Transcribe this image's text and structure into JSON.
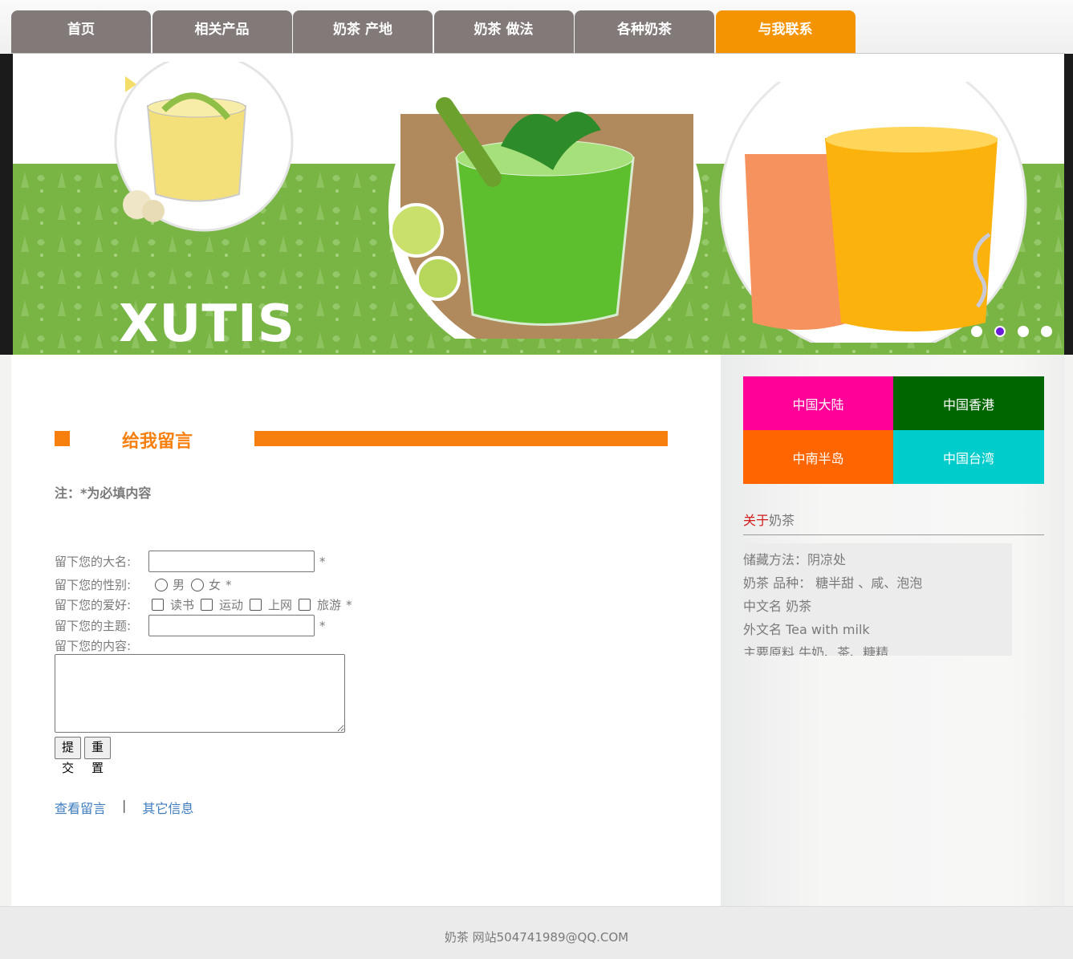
{
  "nav": {
    "tabs": [
      "首页",
      "相关产品",
      "奶茶 产地",
      "奶茶 做法",
      "各种奶茶",
      "与我联系"
    ],
    "active_index": 5,
    "active_color": "#f59403",
    "tab_color": "#827a79"
  },
  "banner": {
    "logo_text": "XUTIS",
    "slide_count": 4,
    "active_slide": 2
  },
  "section": {
    "title": "给我留言",
    "accent_color": "#f77f0e"
  },
  "note": "注：*为必填内容",
  "form": {
    "name_label": "留下您的大名:",
    "gender_label": "留下您的性别:",
    "gender_options": [
      "男",
      "女"
    ],
    "hobby_label": "留下您的爱好:",
    "hobby_options": [
      "读书",
      "运动",
      "上网",
      "旅游"
    ],
    "subject_label": "留下您的主题:",
    "content_label": "留下您的内容:",
    "required_mark": "*",
    "submit_label": "提交",
    "reset_label": "重置"
  },
  "links": {
    "view_messages": "查看留言",
    "separator": "|",
    "other_info": "其它信息"
  },
  "sidebar": {
    "regions": [
      {
        "label": "中国大陆",
        "color": "#ff0099"
      },
      {
        "label": "中国香港",
        "color": "#006600"
      },
      {
        "label": "中南半岛",
        "color": "#ff6600"
      },
      {
        "label": "中国台湾",
        "color": "#00cccc"
      }
    ],
    "about_prefix": "关于",
    "about_suffix": "奶茶",
    "info_lines": [
      "储藏方法：阴凉处",
      "奶茶 品种：  糖半甜 、咸、泡泡",
      "中文名 奶茶",
      "外文名 Tea with milk",
      "主要原料 牛奶、茶、糖精"
    ]
  },
  "footer": {
    "text": "奶茶 网站504741989@QQ.COM"
  }
}
